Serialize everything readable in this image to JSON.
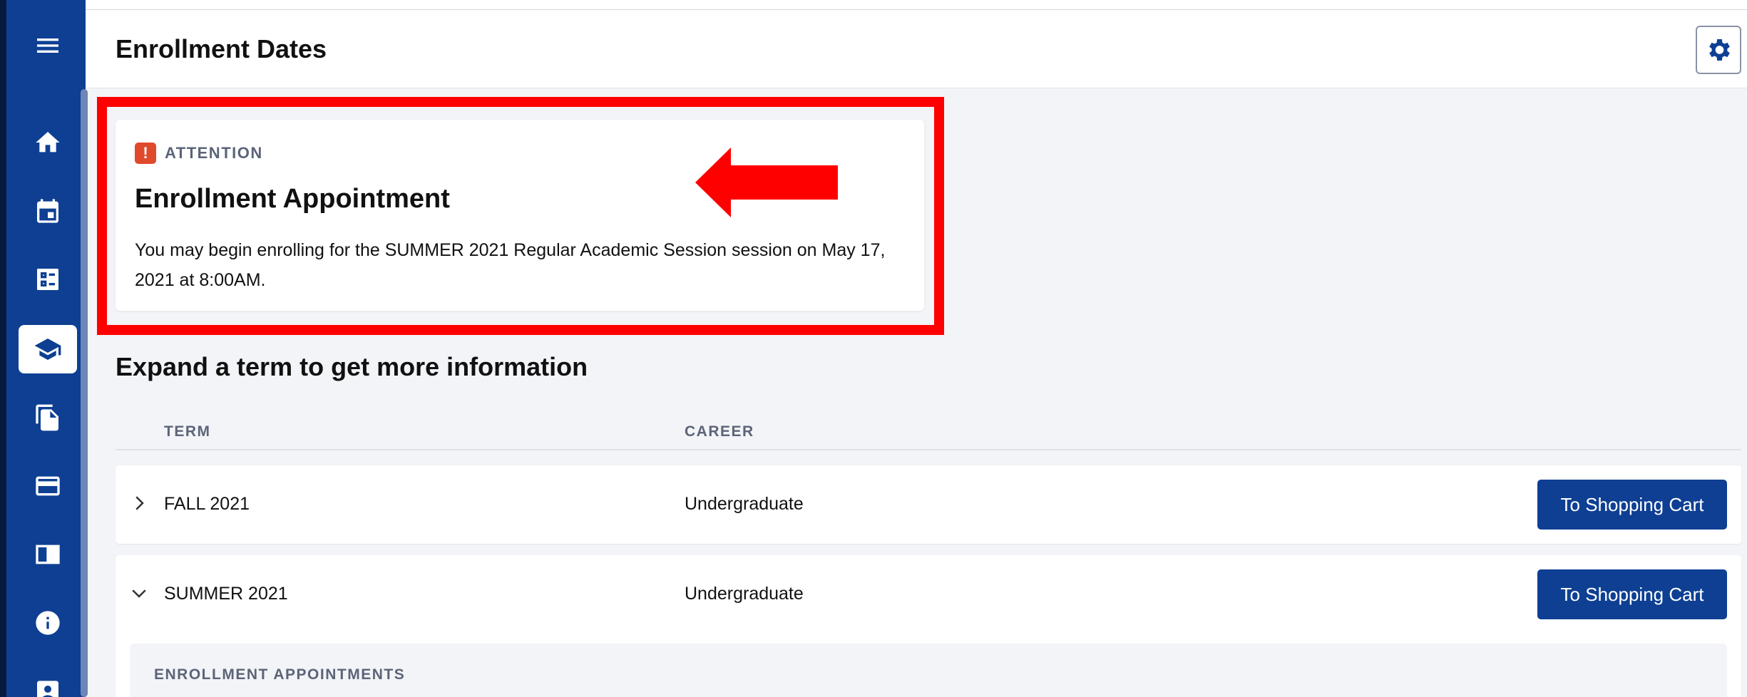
{
  "header": {
    "title": "Enrollment Dates",
    "settings_icon": "gear-icon"
  },
  "sidebar": {
    "items": [
      {
        "name": "menu",
        "icon": "hamburger-icon",
        "active": false
      },
      {
        "name": "home",
        "icon": "home-icon",
        "active": false
      },
      {
        "name": "calendar",
        "icon": "calendar-icon",
        "active": false
      },
      {
        "name": "dashboard",
        "icon": "checklist-icon",
        "active": false
      },
      {
        "name": "academics",
        "icon": "graduation-cap-icon",
        "active": true
      },
      {
        "name": "documents",
        "icon": "documents-icon",
        "active": false
      },
      {
        "name": "payments",
        "icon": "credit-card-icon",
        "active": false
      },
      {
        "name": "catalog",
        "icon": "catalog-icon",
        "active": false
      },
      {
        "name": "info",
        "icon": "info-icon",
        "active": false
      },
      {
        "name": "profile",
        "icon": "profile-icon",
        "active": false
      }
    ]
  },
  "attention": {
    "label": "ATTENTION",
    "icon_text": "!",
    "title": "Enrollment Appointment",
    "message": "You may begin enrolling for the SUMMER 2021 Regular Academic Session session on May 17, 2021 at 8:00AM."
  },
  "section": {
    "title": "Expand a term to get more information",
    "columns": {
      "term": "TERM",
      "career": "CAREER"
    }
  },
  "terms": [
    {
      "term": "FALL 2021",
      "career": "Undergraduate",
      "button": "To Shopping Cart",
      "expanded": false
    },
    {
      "term": "SUMMER 2021",
      "career": "Undergraduate",
      "button": "To Shopping Cart",
      "expanded": true
    }
  ],
  "expanded": {
    "label": "ENROLLMENT APPOINTMENTS"
  },
  "colors": {
    "sidebar": "#0e3f93",
    "primary_button": "#0e3f93",
    "attention_icon": "#e04a2c",
    "highlight": "#ff0000"
  }
}
